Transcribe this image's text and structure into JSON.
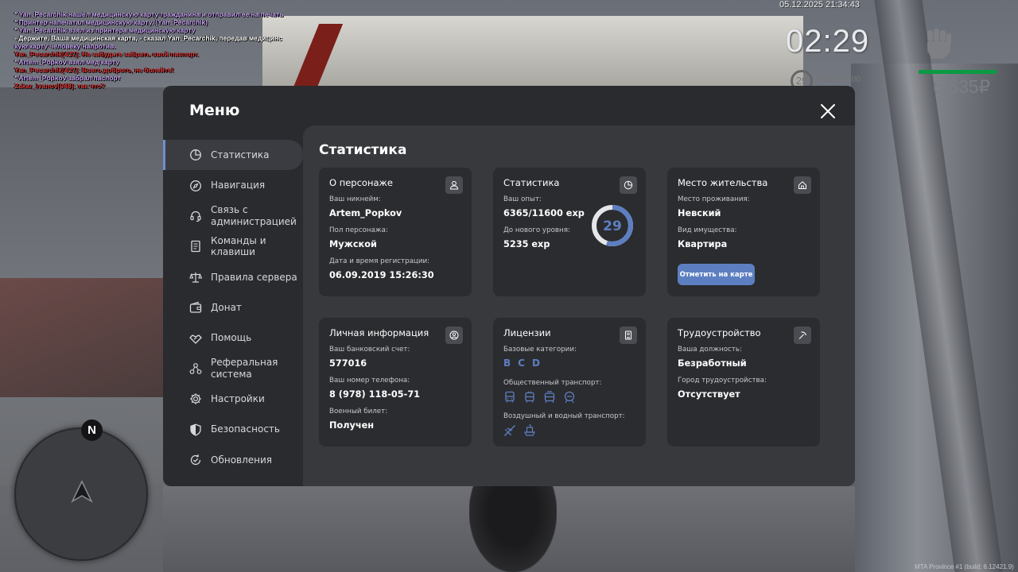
{
  "chat": [
    {
      "text": "* Yan_Pecarchik нашёл медицинскую карту гражданина и отправил ее на печать",
      "color": "purple"
    },
    {
      "text": "* Принтер напечатал медицинскую карту. (Yan_Pecarchik)",
      "color": "purple"
    },
    {
      "text": "* Yan_Pecarchik взял из принтера медицинскую карту",
      "color": "purple"
    },
    {
      "text": "- Держите, Ваша медицинская карта, - сказал Yan_Pecarchik, передав медицинс",
      "color": "mixed"
    },
    {
      "text": "кую карту человеку напротив.",
      "color": "purple"
    },
    {
      "text": "Yan_Pecarchik[427]: Не забудьте забрать свой паспорт.",
      "color": "red-white"
    },
    {
      "text": "* Artem_Popkov взял мед карту",
      "color": "purple"
    },
    {
      "text": "Yan_Pecarchik[427]: Всего доброго, не болейте!",
      "color": "red-white"
    },
    {
      "text": "* Artem_Popkov забрал паспорт",
      "color": "purple"
    },
    {
      "text": "Zakar_Ivanov[948]: так что?",
      "color": "red-white"
    }
  ],
  "hud": {
    "datetime": "05.12.2025 21:34:43",
    "time": "02:29",
    "level": "29",
    "exp": "6365/11600",
    "money": "6 635₽",
    "health_fraction": 1.0,
    "footer": "MTA Province #1 (build: 6.12421.9)",
    "health_color": "#0b9a44"
  },
  "minimap": {
    "north_label": "N"
  },
  "menu": {
    "title": "Меню",
    "accent_color": "#5d7fc1",
    "sidebar": [
      {
        "label": "Статистика",
        "icon": "pie-chart-icon",
        "active": true
      },
      {
        "label": "Навигация",
        "icon": "compass-icon"
      },
      {
        "label": "Связь с администрацией",
        "icon": "headset-icon"
      },
      {
        "label": "Команды и клавиши",
        "icon": "document-icon"
      },
      {
        "label": "Правила сервера",
        "icon": "scales-icon"
      },
      {
        "label": "Донат",
        "icon": "wallet-icon"
      },
      {
        "label": "Помощь",
        "icon": "handshake-icon"
      },
      {
        "label": "Реферальная система",
        "icon": "network-icon"
      },
      {
        "label": "Настройки",
        "icon": "gear-icon"
      },
      {
        "label": "Безопасность",
        "icon": "shield-icon"
      },
      {
        "label": "Обновления",
        "icon": "refresh-check-icon"
      }
    ],
    "content_title": "Статистика",
    "cards": {
      "character": {
        "title": "О персонаже",
        "icon": "user-icon",
        "nickname_label": "Ваш никнейм:",
        "nickname": "Artem_Popkov",
        "gender_label": "Пол персонажа:",
        "gender": "Мужской",
        "reg_label": "Дата и время регистрации:",
        "reg": "06.09.2019 15:26:30"
      },
      "stats": {
        "title": "Статистика",
        "icon": "pie-chart-icon",
        "exp_label": "Ваш опыт:",
        "exp": "6365/11600 exp",
        "next_label": "До нового уровня:",
        "next": "5235 exp",
        "level": "29",
        "progress": 0.5487
      },
      "residence": {
        "title": "Место жительства",
        "icon": "home-icon",
        "place_label": "Место проживания:",
        "place": "Невский",
        "property_label": "Вид имущества:",
        "property": "Квартира",
        "map_button": "Отметить на карте"
      },
      "personal": {
        "title": "Личная информация",
        "icon": "user-circle-icon",
        "bank_label": "Ваш банковский счет:",
        "bank": "577016",
        "phone_label": "Ваш номер телефона:",
        "phone": "8 (978) 118-05-71",
        "military_label": "Военный билет:",
        "military": "Получен"
      },
      "licenses": {
        "title": "Лицензии",
        "icon": "id-card-icon",
        "base_label": "Базовые категории:",
        "base": [
          "B",
          "C",
          "D"
        ],
        "public_label": "Общественный транспорт:",
        "public_icons": [
          "bus-icon",
          "trolleybus-icon",
          "tram-icon",
          "subway-icon"
        ],
        "air_label": "Воздушный и водный транспорт:",
        "air_icons": [
          "plane-icon",
          "boat-icon"
        ]
      },
      "employment": {
        "title": "Трудоустройство",
        "icon": "pickaxe-icon",
        "position_label": "Ваша должность:",
        "position": "Безработный",
        "city_label": "Город трудоустройства:",
        "city": "Отсутствует"
      }
    }
  }
}
